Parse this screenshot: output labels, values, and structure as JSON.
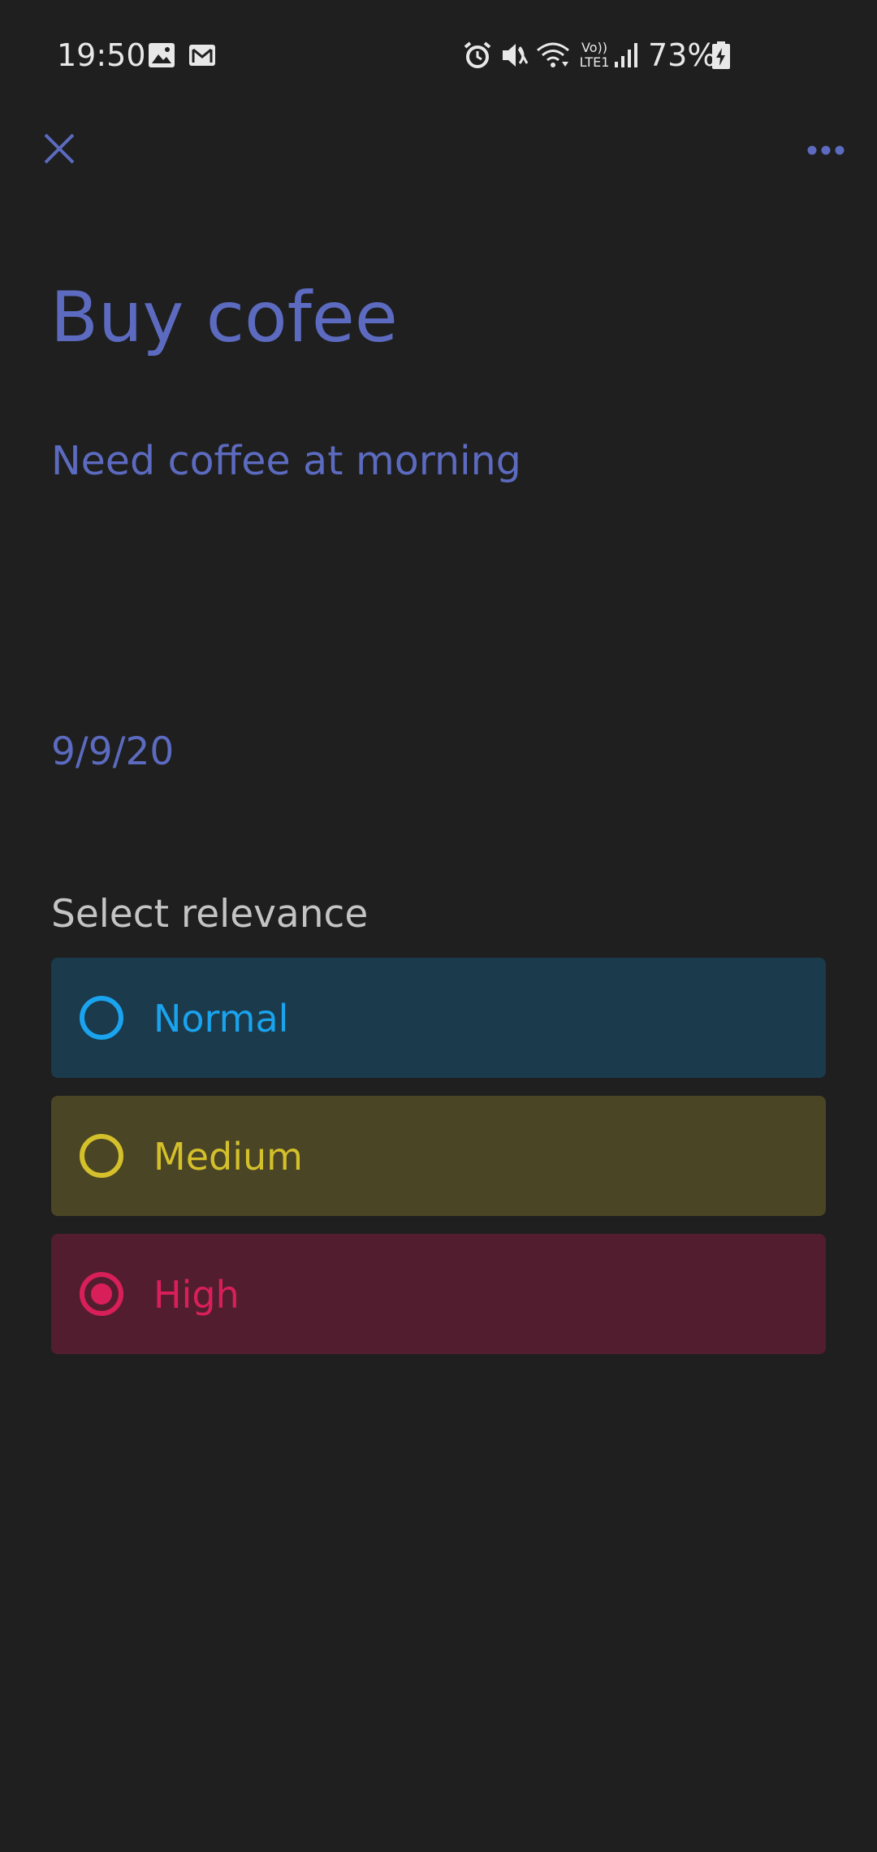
{
  "status_bar": {
    "time": "19:50",
    "battery_percent": "73%",
    "network_label_top": "Vo))",
    "network_label_bottom": "LTE1",
    "icons": [
      "image-icon",
      "gmail-icon",
      "alarm-icon",
      "mute-icon",
      "wifi-icon",
      "signal-icon",
      "battery-charging-icon"
    ]
  },
  "app_bar": {
    "close_icon": "close-icon",
    "more_icon": "more-horizontal-icon"
  },
  "task": {
    "title": "Buy cofee",
    "description": "Need coffee at morning",
    "date": "9/9/20"
  },
  "relevance": {
    "label": "Select relevance",
    "options": [
      {
        "label": "Normal",
        "selected": false,
        "color": "#1aa3ee",
        "background": "#1b3a4b"
      },
      {
        "label": "Medium",
        "selected": false,
        "color": "#d4c02b",
        "background": "#4a4525"
      },
      {
        "label": "High",
        "selected": true,
        "color": "#d91f5a",
        "background": "#521e2f"
      }
    ]
  },
  "colors": {
    "background": "#1f1f1f",
    "accent": "#5c6bc0",
    "status_text": "#e8e8e8"
  }
}
